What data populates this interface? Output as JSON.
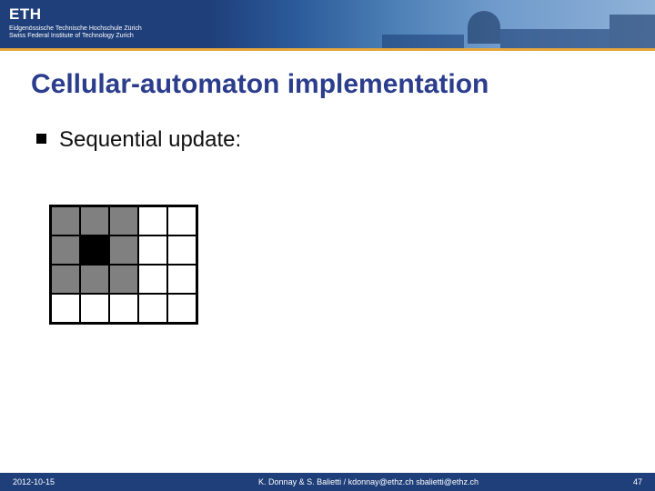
{
  "header": {
    "logo": "ETH",
    "sub1": "Eidgenössische Technische Hochschule Zürich",
    "sub2": "Swiss Federal Institute of Technology Zurich"
  },
  "title": "Cellular-automaton implementation",
  "bullet1": "Sequential update:",
  "grid": {
    "rows": 4,
    "cols": 5,
    "neighbors": [
      [
        0,
        0
      ],
      [
        0,
        1
      ],
      [
        0,
        2
      ],
      [
        1,
        0
      ],
      [
        1,
        2
      ],
      [
        2,
        0
      ],
      [
        2,
        1
      ],
      [
        2,
        2
      ]
    ],
    "center": [
      1,
      1
    ]
  },
  "footer": {
    "date": "2012-10-15",
    "center": "K. Donnay & S. Balietti / kdonnay@ethz.ch   sbalietti@ethz.ch",
    "page": "47"
  }
}
